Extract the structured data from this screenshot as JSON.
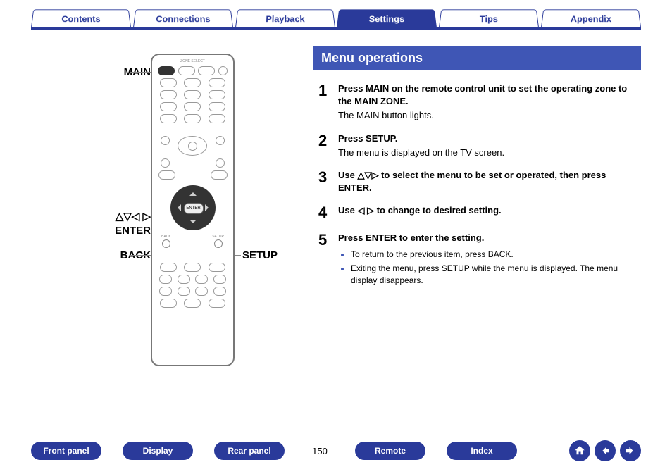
{
  "tabs": {
    "contents": "Contents",
    "connections": "Connections",
    "playback": "Playback",
    "settings": "Settings",
    "tips": "Tips",
    "appendix": "Appendix",
    "active": "settings"
  },
  "remote_labels": {
    "main": "MAIN",
    "arrows_enter_prefix": "△▽◁ ▷",
    "enter": "ENTER",
    "back": "BACK",
    "setup": "SETUP"
  },
  "remote_internal": {
    "zone_select": "ZONE SELECT",
    "enter_btn": "ENTER",
    "back_btn": "BACK",
    "setup_btn": "SETUP"
  },
  "section_title": "Menu operations",
  "steps": [
    {
      "num": "1",
      "bold": "Press MAIN on the remote control unit to set the operating zone to the MAIN ZONE.",
      "note": "The MAIN button lights."
    },
    {
      "num": "2",
      "bold": "Press SETUP.",
      "note": "The menu is displayed on the TV screen."
    },
    {
      "num": "3",
      "bold_pre": "Use ",
      "bold_glyph": "△▽▷",
      "bold_post": " to select the menu to be set or operated, then press ENTER."
    },
    {
      "num": "4",
      "bold_pre": "Use ",
      "bold_glyph": "◁ ▷",
      "bold_post": " to change to desired setting."
    },
    {
      "num": "5",
      "bold": "Press ENTER to enter the setting.",
      "bullets": [
        "To return to the previous item, press BACK.",
        "Exiting the menu, press SETUP while the menu is displayed. The menu display disappears."
      ]
    }
  ],
  "bottom_nav": {
    "front_panel": "Front panel",
    "display": "Display",
    "rear_panel": "Rear panel",
    "remote": "Remote",
    "index": "Index"
  },
  "page_number": "150"
}
